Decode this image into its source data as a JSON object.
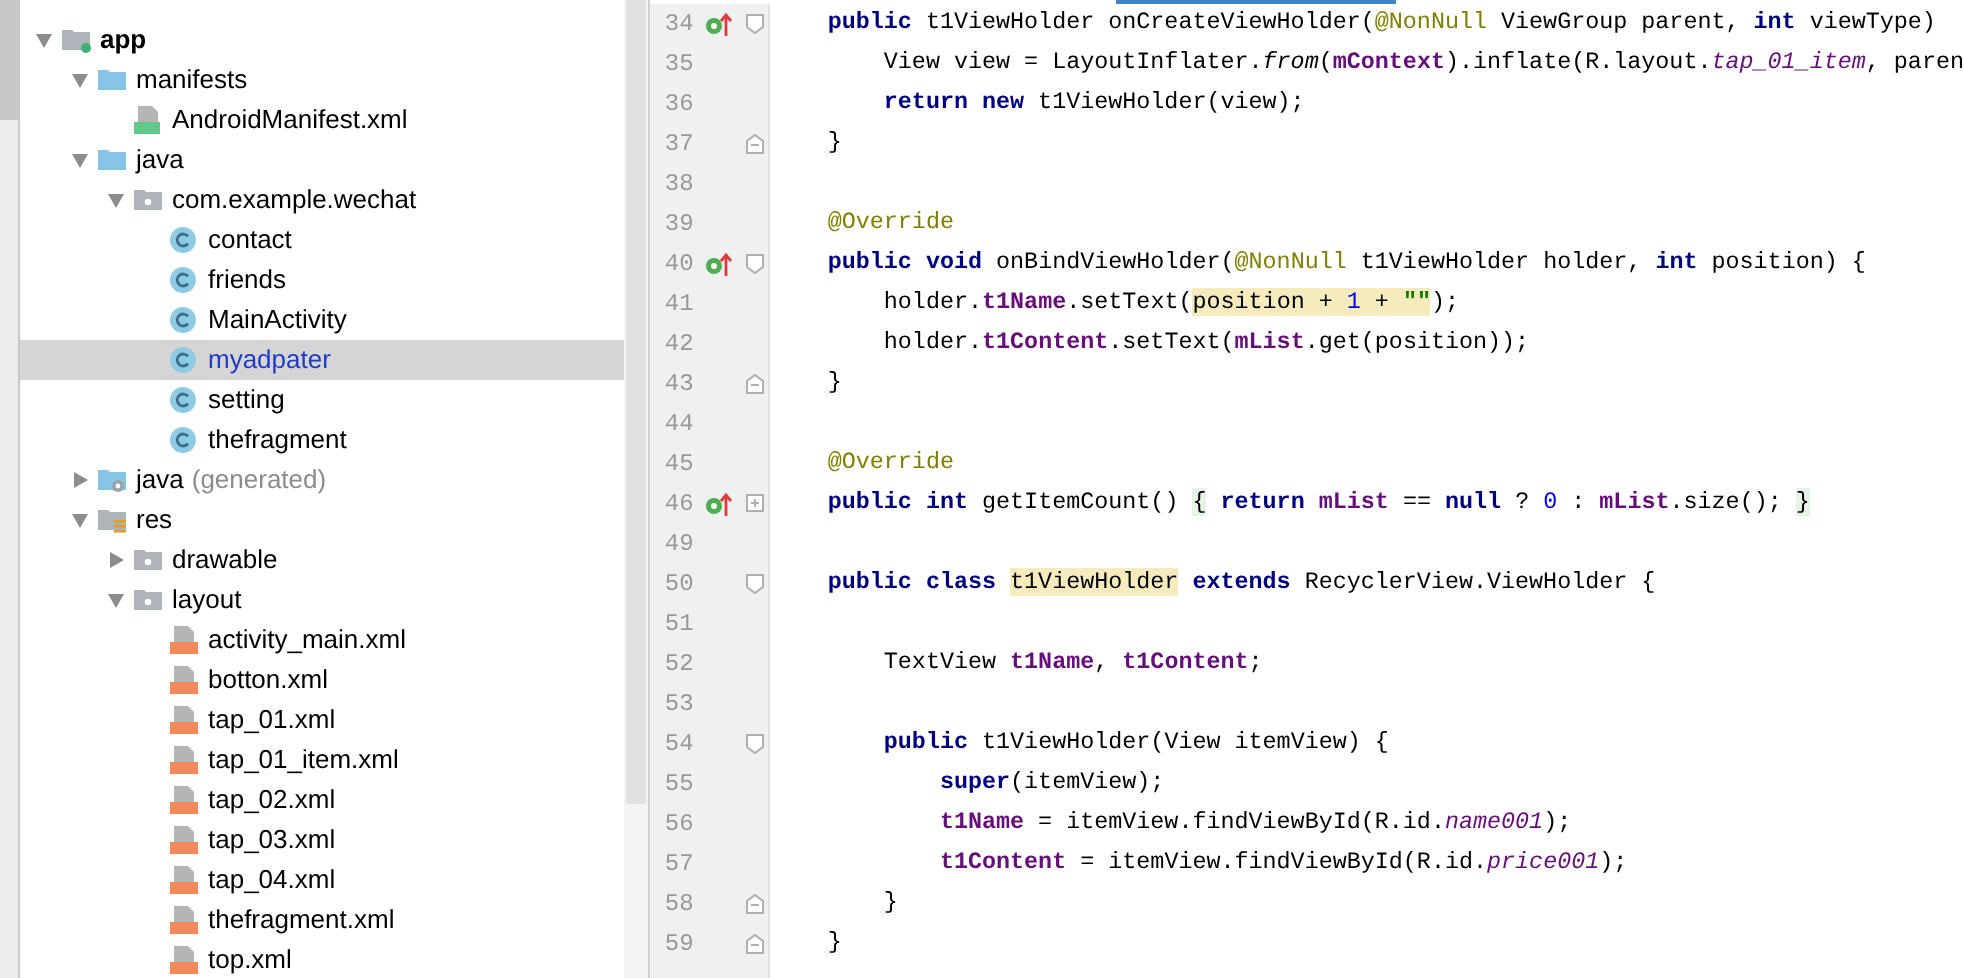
{
  "project_tree": [
    {
      "label": "app",
      "kind": "module",
      "bold": true,
      "expanded": true,
      "children": [
        {
          "label": "manifests",
          "kind": "folder",
          "expanded": true,
          "children": [
            {
              "label": "AndroidManifest.xml",
              "kind": "manifest"
            }
          ]
        },
        {
          "label": "java",
          "kind": "folder",
          "expanded": true,
          "children": [
            {
              "label": "com.example.wechat",
              "kind": "package",
              "expanded": true,
              "children": [
                {
                  "label": "contact",
                  "kind": "class",
                  "selected": false
                },
                {
                  "label": "friends",
                  "kind": "class",
                  "selected": false
                },
                {
                  "label": "MainActivity",
                  "kind": "class",
                  "selected": false
                },
                {
                  "label": "myadpater",
                  "kind": "class",
                  "selected": true
                },
                {
                  "label": "setting",
                  "kind": "class",
                  "selected": false
                },
                {
                  "label": "thefragment",
                  "kind": "class",
                  "selected": false
                }
              ]
            }
          ]
        },
        {
          "label": "java",
          "note": "(generated)",
          "kind": "generated",
          "expanded": false
        },
        {
          "label": "res",
          "kind": "res",
          "expanded": true,
          "children": [
            {
              "label": "drawable",
              "kind": "package",
              "expanded": false
            },
            {
              "label": "layout",
              "kind": "package",
              "expanded": true,
              "children": [
                {
                  "label": "activity_main.xml",
                  "kind": "layout"
                },
                {
                  "label": "botton.xml",
                  "kind": "layout"
                },
                {
                  "label": "tap_01.xml",
                  "kind": "layout"
                },
                {
                  "label": "tap_01_item.xml",
                  "kind": "layout"
                },
                {
                  "label": "tap_02.xml",
                  "kind": "layout"
                },
                {
                  "label": "tap_03.xml",
                  "kind": "layout"
                },
                {
                  "label": "tap_04.xml",
                  "kind": "layout"
                },
                {
                  "label": "thefragment.xml",
                  "kind": "layout"
                },
                {
                  "label": "top.xml",
                  "kind": "layout"
                }
              ]
            }
          ]
        }
      ]
    }
  ],
  "editor_lines": [
    {
      "line_number": "34",
      "marker": {
        "kind": "override"
      },
      "fold": {
        "kind": "start"
      },
      "tokens": [
        {
          "kind": "keyword",
          "text": "    public"
        },
        {
          "kind": "plain",
          "text": " t1ViewHolder onCreateViewHolder("
        },
        {
          "kind": "annotation",
          "text": "@NonNull"
        },
        {
          "kind": "plain",
          "text": " ViewGroup parent, "
        },
        {
          "kind": "keyword",
          "text": "int"
        },
        {
          "kind": "plain",
          "text": " viewType)"
        }
      ]
    },
    {
      "line_number": "35",
      "tokens": [
        {
          "kind": "plain",
          "text": "        View view = LayoutInflater."
        },
        {
          "kind": "italic",
          "text": "from"
        },
        {
          "kind": "plain",
          "text": "("
        },
        {
          "kind": "field",
          "text": "mContext"
        },
        {
          "kind": "plain",
          "text": ").inflate(R.layout."
        },
        {
          "kind": "static",
          "text": "tap_01_item"
        },
        {
          "kind": "plain",
          "text": ", paren"
        }
      ]
    },
    {
      "line_number": "36",
      "tokens": [
        {
          "kind": "keyword",
          "text": "        return new"
        },
        {
          "kind": "plain",
          "text": " t1ViewHolder(view);"
        }
      ]
    },
    {
      "line_number": "37",
      "fold": {
        "kind": "end"
      },
      "tokens": [
        {
          "kind": "plain",
          "text": "    }"
        }
      ]
    },
    {
      "line_number": "38"
    },
    {
      "line_number": "39",
      "tokens": [
        {
          "kind": "annotation",
          "text": "    @Override"
        }
      ]
    },
    {
      "line_number": "40",
      "marker": {
        "kind": "override"
      },
      "fold": {
        "kind": "start"
      },
      "tokens": [
        {
          "kind": "keyword",
          "text": "    public void"
        },
        {
          "kind": "plain",
          "text": " onBindViewHolder("
        },
        {
          "kind": "annotation",
          "text": "@NonNull"
        },
        {
          "kind": "plain",
          "text": " t1ViewHolder holder, "
        },
        {
          "kind": "keyword",
          "text": "int"
        },
        {
          "kind": "plain",
          "text": " position) {"
        }
      ]
    },
    {
      "line_number": "41",
      "tokens": [
        {
          "kind": "plain",
          "text": "        holder."
        },
        {
          "kind": "field",
          "text": "t1Name"
        },
        {
          "kind": "plain",
          "text": ".setText("
        },
        {
          "kind": "plain",
          "text": "position + ",
          "color": "#f6ebbc"
        },
        {
          "kind": "number",
          "text": "1",
          "color": "#f6ebbc"
        },
        {
          "kind": "plain",
          "text": " + ",
          "color": "#f6ebbc"
        },
        {
          "kind": "string",
          "text": "\"\"",
          "color": "#f6ebbc"
        },
        {
          "kind": "plain",
          "text": ");"
        }
      ]
    },
    {
      "line_number": "42",
      "tokens": [
        {
          "kind": "plain",
          "text": "        holder."
        },
        {
          "kind": "field",
          "text": "t1Content"
        },
        {
          "kind": "plain",
          "text": ".setText("
        },
        {
          "kind": "field",
          "text": "mList"
        },
        {
          "kind": "plain",
          "text": ".get(position));"
        }
      ]
    },
    {
      "line_number": "43",
      "fold": {
        "kind": "end"
      },
      "tokens": [
        {
          "kind": "plain",
          "text": "    }"
        }
      ]
    },
    {
      "line_number": "44"
    },
    {
      "line_number": "45",
      "tokens": [
        {
          "kind": "annotation",
          "text": "    @Override"
        }
      ]
    },
    {
      "line_number": "46",
      "marker": {
        "kind": "override"
      },
      "fold": {
        "kind": "collapsed"
      },
      "tokens": [
        {
          "kind": "keyword",
          "text": "    public int"
        },
        {
          "kind": "plain",
          "text": " getItemCount() "
        },
        {
          "kind": "plain",
          "text": "{",
          "color": "#e6f4e6"
        },
        {
          "kind": "keyword",
          "text": " return"
        },
        {
          "kind": "field",
          "text": " mList"
        },
        {
          "kind": "plain",
          "text": " == "
        },
        {
          "kind": "keyword",
          "text": "null"
        },
        {
          "kind": "plain",
          "text": " ? "
        },
        {
          "kind": "number",
          "text": "0"
        },
        {
          "kind": "plain",
          "text": " : "
        },
        {
          "kind": "field",
          "text": "mList"
        },
        {
          "kind": "plain",
          "text": ".size(); "
        },
        {
          "kind": "plain",
          "text": "}",
          "color": "#e6f4e6"
        }
      ]
    },
    {
      "line_number": "49"
    },
    {
      "line_number": "50",
      "fold": {
        "kind": "start"
      },
      "tokens": [
        {
          "kind": "keyword",
          "text": "    public class "
        },
        {
          "kind": "plain",
          "text": "t1ViewHolder",
          "color": "#f6ebbc"
        },
        {
          "kind": "keyword",
          "text": " extends"
        },
        {
          "kind": "plain",
          "text": " RecyclerView.ViewHolder {"
        }
      ]
    },
    {
      "line_number": "51"
    },
    {
      "line_number": "52",
      "tokens": [
        {
          "kind": "plain",
          "text": "        TextView "
        },
        {
          "kind": "field",
          "text": "t1Name"
        },
        {
          "kind": "plain",
          "text": ", "
        },
        {
          "kind": "field",
          "text": "t1Content"
        },
        {
          "kind": "plain",
          "text": ";"
        }
      ]
    },
    {
      "line_number": "53"
    },
    {
      "line_number": "54",
      "fold": {
        "kind": "start"
      },
      "tokens": [
        {
          "kind": "keyword",
          "text": "        public"
        },
        {
          "kind": "plain",
          "text": " t1ViewHolder(View itemView) {"
        }
      ]
    },
    {
      "line_number": "55",
      "tokens": [
        {
          "kind": "keyword",
          "text": "            super"
        },
        {
          "kind": "plain",
          "text": "(itemView);"
        }
      ]
    },
    {
      "line_number": "56",
      "tokens": [
        {
          "kind": "field",
          "text": "            t1Name"
        },
        {
          "kind": "plain",
          "text": " = itemView.findViewById(R.id."
        },
        {
          "kind": "static",
          "text": "name001"
        },
        {
          "kind": "plain",
          "text": ");"
        }
      ]
    },
    {
      "line_number": "57",
      "tokens": [
        {
          "kind": "field",
          "text": "            t1Content"
        },
        {
          "kind": "plain",
          "text": " = itemView.findViewById(R.id."
        },
        {
          "kind": "static",
          "text": "price001"
        },
        {
          "kind": "plain",
          "text": ");"
        }
      ]
    },
    {
      "line_number": "58",
      "fold": {
        "kind": "end"
      },
      "tokens": [
        {
          "kind": "plain",
          "text": "        }"
        }
      ]
    },
    {
      "line_number": "59",
      "fold": {
        "kind": "end"
      },
      "tokens": [
        {
          "kind": "plain",
          "text": "    }"
        }
      ]
    }
  ]
}
